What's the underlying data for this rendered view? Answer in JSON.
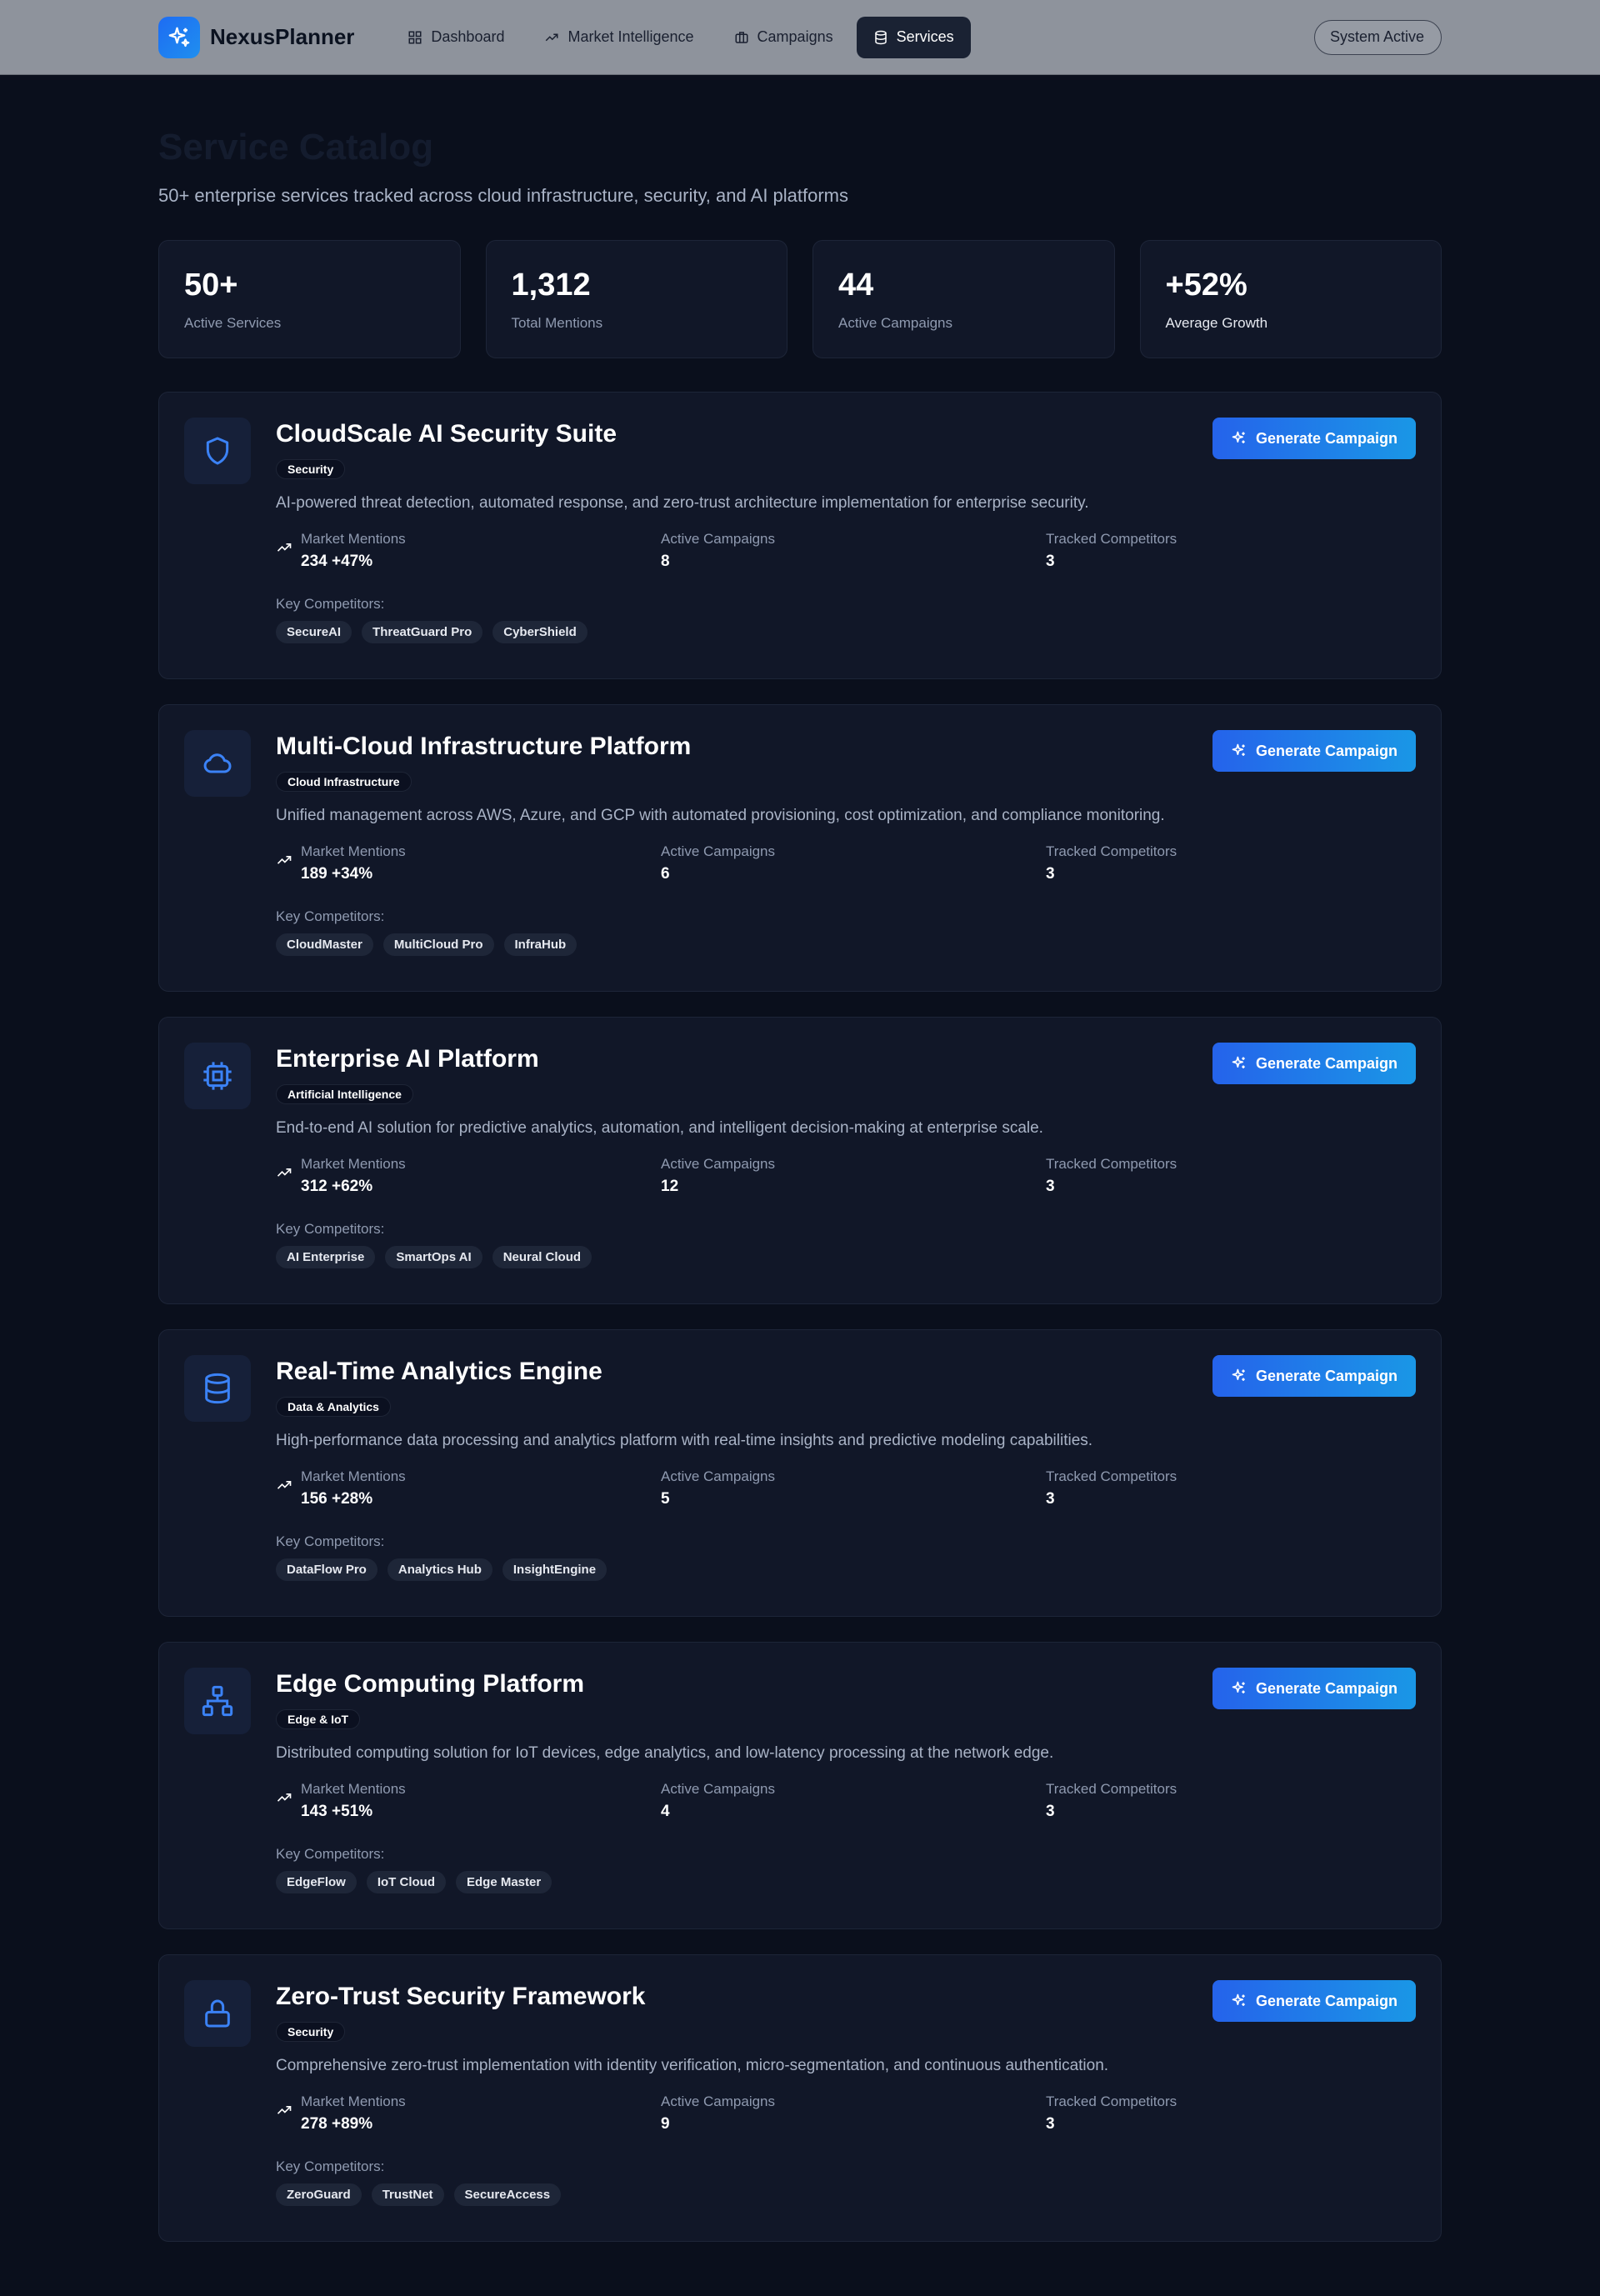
{
  "app": {
    "name": "NexusPlanner",
    "status": "System Active"
  },
  "nav": [
    {
      "label": "Dashboard",
      "icon": "grid-icon"
    },
    {
      "label": "Market Intelligence",
      "icon": "trend-icon"
    },
    {
      "label": "Campaigns",
      "icon": "briefcase-icon"
    },
    {
      "label": "Services",
      "icon": "database-icon",
      "active": true
    }
  ],
  "page": {
    "title": "Service Catalog",
    "subtitle": "50+ enterprise services tracked across cloud infrastructure, security, and AI platforms"
  },
  "stats": [
    {
      "value": "50+",
      "label": "Active Services"
    },
    {
      "value": "1,312",
      "label": "Total Mentions"
    },
    {
      "value": "44",
      "label": "Active Campaigns"
    },
    {
      "value": "+52%",
      "label": "Average Growth"
    }
  ],
  "labels": {
    "market_mentions": "Market Mentions",
    "active_campaigns": "Active Campaigns",
    "tracked_competitors": "Tracked Competitors",
    "key_competitors": "Key Competitors:",
    "generate_campaign": "Generate Campaign"
  },
  "services": [
    {
      "title": "CloudScale AI Security Suite",
      "icon": "shield-icon",
      "category": "Security",
      "description": "AI-powered threat detection, automated response, and zero-trust architecture implementation for enterprise security.",
      "mentions": "234 +47%",
      "campaigns": "8",
      "competitors_count": "3",
      "competitors": [
        "SecureAI",
        "ThreatGuard Pro",
        "CyberShield"
      ]
    },
    {
      "title": "Multi-Cloud Infrastructure Platform",
      "icon": "cloud-icon",
      "category": "Cloud Infrastructure",
      "description": "Unified management across AWS, Azure, and GCP with automated provisioning, cost optimization, and compliance monitoring.",
      "mentions": "189 +34%",
      "campaigns": "6",
      "competitors_count": "3",
      "competitors": [
        "CloudMaster",
        "MultiCloud Pro",
        "InfraHub"
      ]
    },
    {
      "title": "Enterprise AI Platform",
      "icon": "cpu-icon",
      "category": "Artificial Intelligence",
      "description": "End-to-end AI solution for predictive analytics, automation, and intelligent decision-making at enterprise scale.",
      "mentions": "312 +62%",
      "campaigns": "12",
      "competitors_count": "3",
      "competitors": [
        "AI Enterprise",
        "SmartOps AI",
        "Neural Cloud"
      ]
    },
    {
      "title": "Real-Time Analytics Engine",
      "icon": "database-icon",
      "category": "Data & Analytics",
      "description": "High-performance data processing and analytics platform with real-time insights and predictive modeling capabilities.",
      "mentions": "156 +28%",
      "campaigns": "5",
      "competitors_count": "3",
      "competitors": [
        "DataFlow Pro",
        "Analytics Hub",
        "InsightEngine"
      ]
    },
    {
      "title": "Edge Computing Platform",
      "icon": "network-icon",
      "category": "Edge & IoT",
      "description": "Distributed computing solution for IoT devices, edge analytics, and low-latency processing at the network edge.",
      "mentions": "143 +51%",
      "campaigns": "4",
      "competitors_count": "3",
      "competitors": [
        "EdgeFlow",
        "IoT Cloud",
        "Edge Master"
      ]
    },
    {
      "title": "Zero-Trust Security Framework",
      "icon": "lock-icon",
      "category": "Security",
      "description": "Comprehensive zero-trust implementation with identity verification, micro-segmentation, and continuous authentication.",
      "mentions": "278 +89%",
      "campaigns": "9",
      "competitors_count": "3",
      "competitors": [
        "ZeroGuard",
        "TrustNet",
        "SecureAccess"
      ]
    }
  ]
}
